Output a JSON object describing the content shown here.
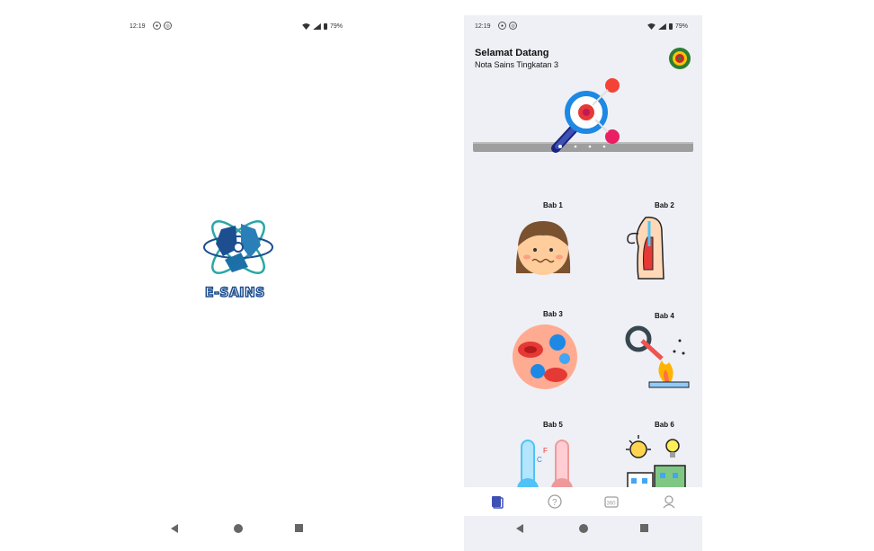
{
  "splash": {
    "status": {
      "time": "12:19",
      "battery": "79%"
    },
    "logo_text": "E-SAINS",
    "colors": {
      "logo_dark": "#1d4e8f",
      "logo_teal": "#2aa6a6"
    }
  },
  "home": {
    "status": {
      "time": "12:19",
      "battery": "79%"
    },
    "welcome_title": "Selamat Datang",
    "welcome_subtitle": "Nota Sains Tingkatan 3",
    "banner": {
      "pages": 4,
      "active_page": 1
    },
    "chapters": [
      {
        "label": "Bab 1",
        "icon": "face-icon"
      },
      {
        "label": "Bab 2",
        "icon": "lungs-icon"
      },
      {
        "label": "Bab 3",
        "icon": "blood-cells-icon"
      },
      {
        "label": "Bab 4",
        "icon": "burner-experiment-icon"
      },
      {
        "label": "Bab 5",
        "icon": "thermometer-icon"
      },
      {
        "label": "Bab 6",
        "icon": "energy-city-icon"
      }
    ],
    "bottom_nav": [
      {
        "name": "notes-tab",
        "icon": "book-icon",
        "active": true
      },
      {
        "name": "quiz-tab",
        "icon": "question-icon",
        "active": false
      },
      {
        "name": "view360-tab",
        "icon": "camera-360-icon",
        "active": false
      },
      {
        "name": "profile-tab",
        "icon": "user-icon",
        "active": false
      }
    ],
    "colors": {
      "accent": "#3f51b5",
      "background": "#eef0f5"
    }
  }
}
